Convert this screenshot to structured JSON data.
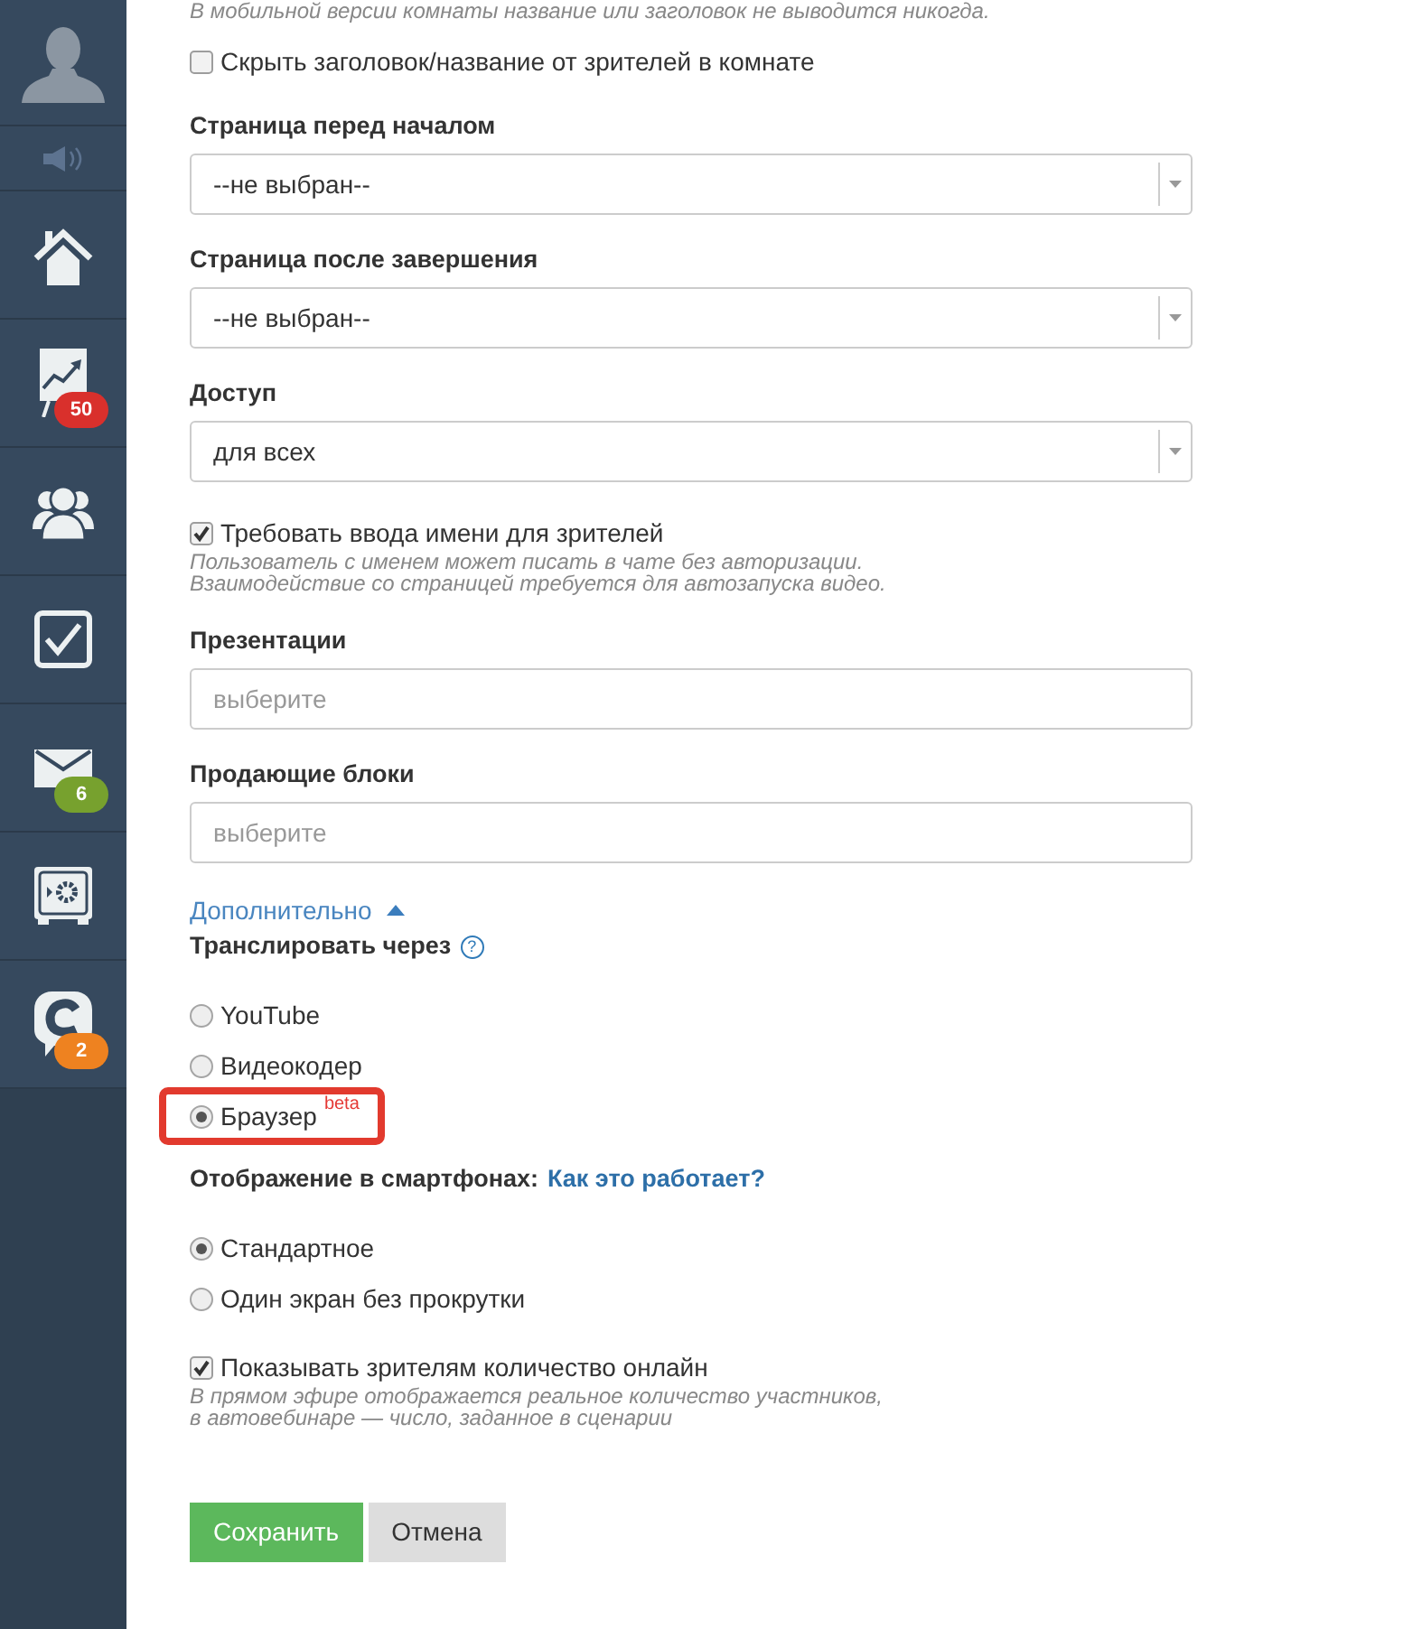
{
  "sidebar": {
    "items": [
      {
        "kind": "avatar"
      },
      {
        "kind": "speaker"
      },
      {
        "kind": "home"
      },
      {
        "kind": "chart",
        "badge": "50",
        "color": "#d9302c"
      },
      {
        "kind": "group"
      },
      {
        "kind": "check"
      },
      {
        "kind": "mail",
        "badge": "6",
        "color": "#77a12e"
      },
      {
        "kind": "safe"
      },
      {
        "kind": "chat",
        "badge": "2",
        "color": "#ee8220"
      }
    ]
  },
  "form": {
    "fields": [
      {
        "kind": "note",
        "text": "В мобильной версии комнаты название или заголовок не выводится никогда."
      },
      {
        "kind": "checkbox",
        "label": "Скрыть заголовок/название от зрителей в комнате",
        "checked": false
      },
      {
        "kind": "select",
        "label": "Страница перед началом",
        "value": "--не выбран--"
      },
      {
        "kind": "select",
        "label": "Страница после завершения",
        "value": "--не выбран--"
      },
      {
        "kind": "select",
        "label": "Доступ",
        "value": "для всех"
      },
      {
        "kind": "checkbox",
        "label": "Требовать ввода имени для зрителей",
        "checked": true,
        "hint": "Пользователь с именем может писать в чате без авторизации.\nВзаимодействие со страницей требуется для автозапуска видео."
      },
      {
        "kind": "input",
        "label": "Презентации",
        "placeholder": "выберите"
      },
      {
        "kind": "input",
        "label": "Продающие блоки",
        "placeholder": "выберите"
      },
      {
        "kind": "toggle",
        "label": "Дополнительно",
        "expanded": true
      },
      {
        "kind": "radio_group",
        "heading": "Транслировать через",
        "help": "?",
        "options": [
          {
            "label": "YouTube",
            "selected": false,
            "highlighted": false
          },
          {
            "label": "Видеокодер",
            "selected": false,
            "highlighted": false
          },
          {
            "label": "Браузер",
            "badge": "beta",
            "selected": true,
            "highlighted": true
          }
        ]
      },
      {
        "kind": "radio_group",
        "heading": "Отображение в смартфонах:",
        "link": "Как это работает?",
        "options": [
          {
            "label": "Стандартное",
            "selected": true
          },
          {
            "label": "Один экран без прокрутки",
            "selected": false
          }
        ]
      },
      {
        "kind": "checkbox",
        "label": "Показывать зрителям количество онлайн",
        "checked": true,
        "hint": "В прямом эфире отображается реальное количество участников,\nв автовебинаре — число, заданное в сценарии"
      },
      {
        "kind": "buttons",
        "buttons": [
          {
            "label": "Сохранить",
            "kind": "primary"
          },
          {
            "label": "Отмена",
            "kind": "secondary"
          }
        ]
      }
    ]
  }
}
